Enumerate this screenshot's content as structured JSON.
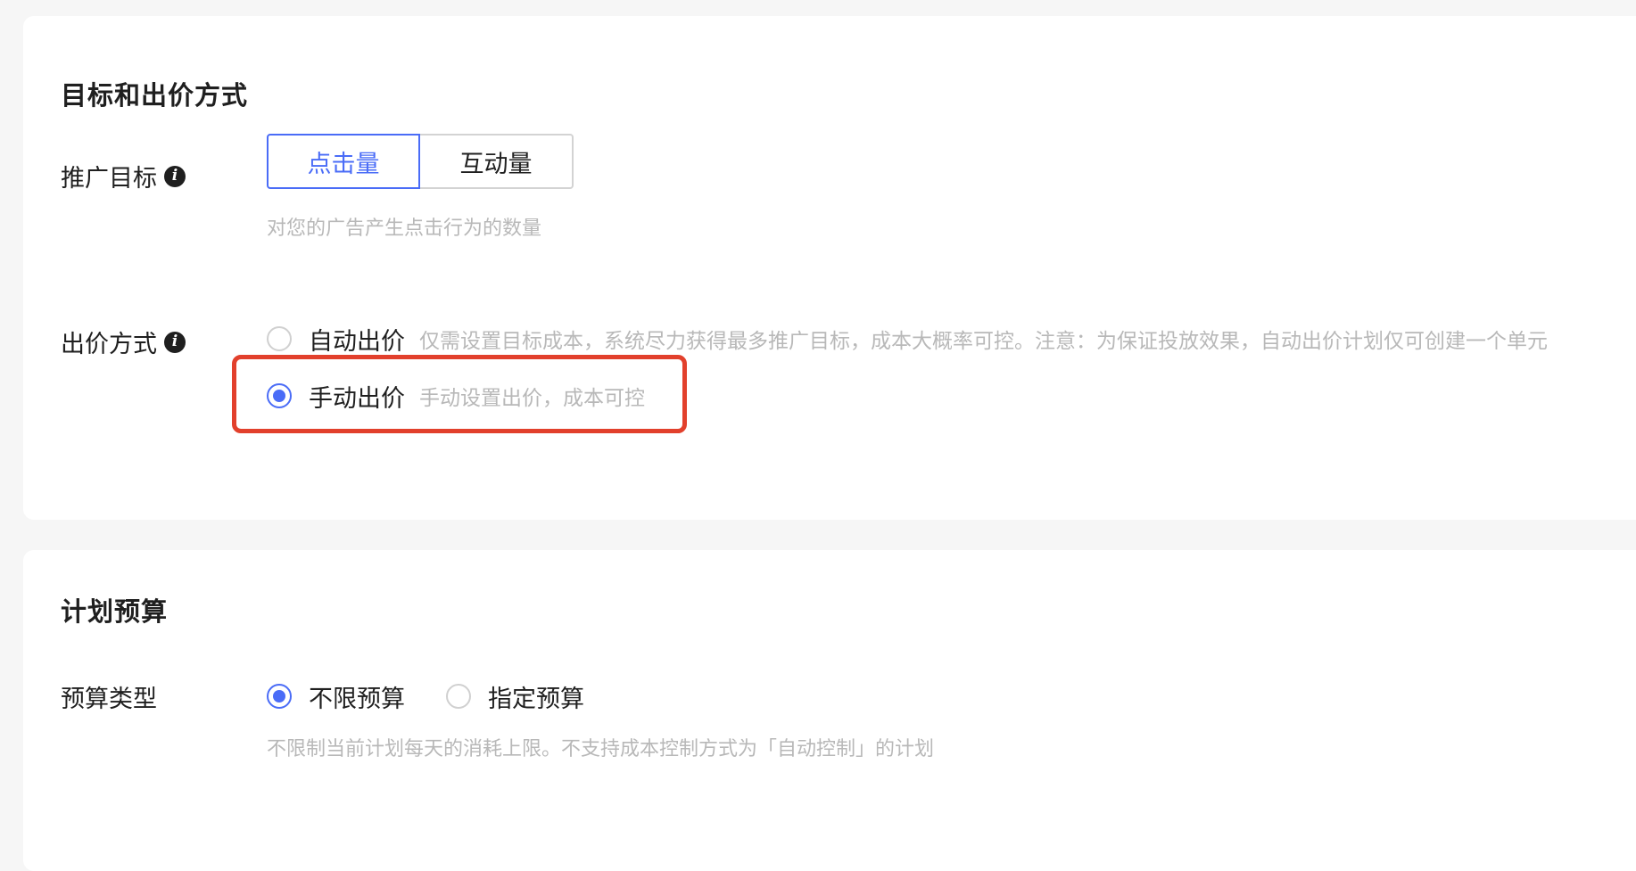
{
  "goal_section": {
    "title": "目标和出价方式",
    "promotion_goal": {
      "label": "推广目标",
      "info_icon": "info-icon",
      "options": [
        "点击量",
        "互动量"
      ],
      "selected": "点击量",
      "hint": "对您的广告产生点击行为的数量"
    },
    "bid_method": {
      "label": "出价方式",
      "info_icon": "info-icon",
      "options": [
        {
          "label": "自动出价",
          "desc": "仅需设置目标成本，系统尽力获得最多推广目标，成本大概率可控。注意：为保证投放效果，自动出价计划仅可创建一个单元",
          "checked": false
        },
        {
          "label": "手动出价",
          "desc": "手动设置出价，成本可控",
          "checked": true
        }
      ],
      "highlight_color": "#e2402c"
    }
  },
  "budget_section": {
    "title": "计划预算",
    "budget_type": {
      "label": "预算类型",
      "options": [
        {
          "label": "不限预算",
          "checked": true
        },
        {
          "label": "指定预算",
          "checked": false
        }
      ],
      "hint": "不限制当前计划每天的消耗上限。不支持成本控制方式为「自动控制」的计划"
    }
  },
  "colors": {
    "accent": "#4a6cf7",
    "hint": "#b8b8b8",
    "highlight": "#e2402c",
    "background": "#f6f6f6"
  }
}
